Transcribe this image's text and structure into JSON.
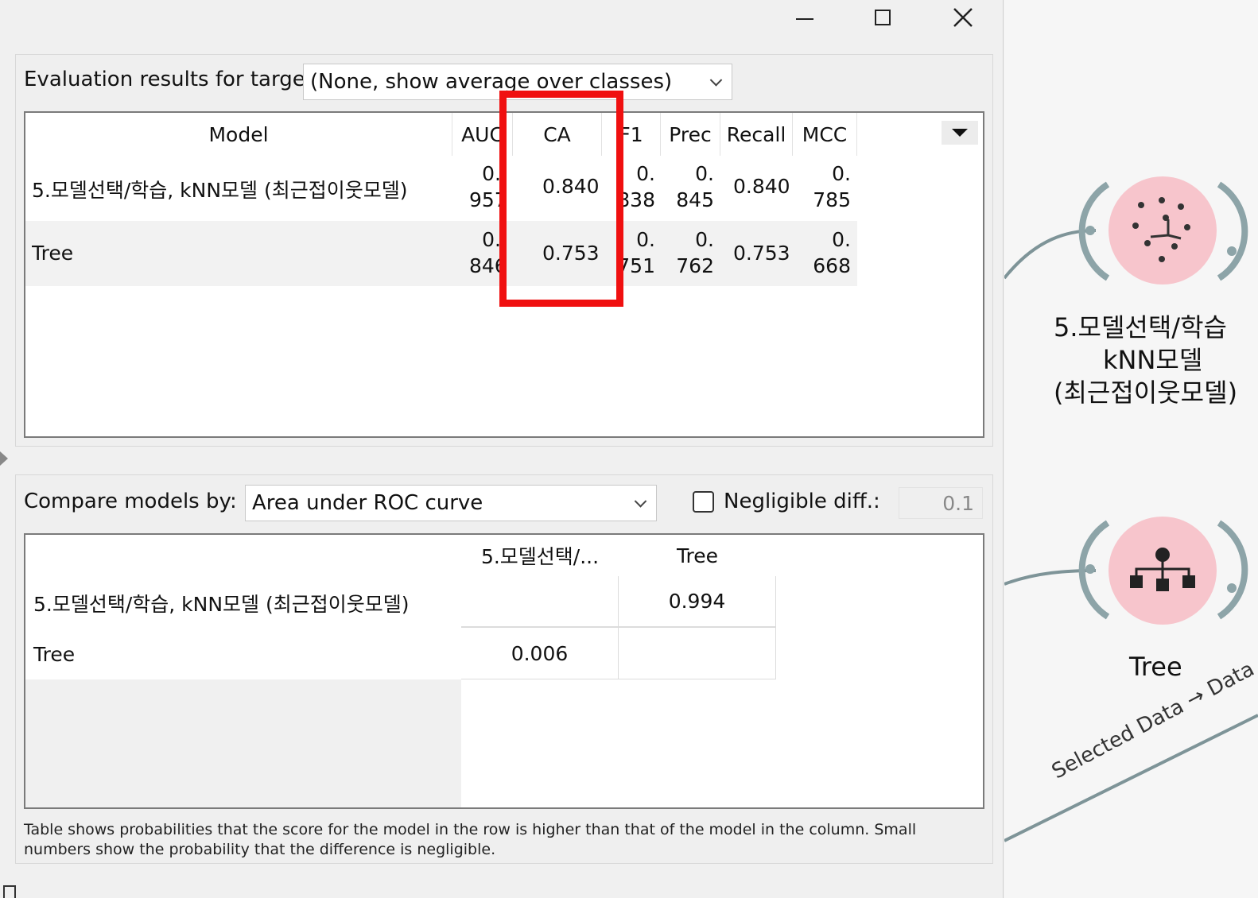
{
  "evaluation": {
    "target_label": "Evaluation results for target",
    "target_value": "(None, show average over classes)",
    "columns": [
      "Model",
      "AUC",
      "CA",
      "F1",
      "Prec",
      "Recall",
      "MCC"
    ],
    "rows": [
      {
        "model": "5.모델선택/학습, kNN모델 (최근접이웃모델)",
        "auc_top": "0.",
        "auc_bottom": "957",
        "ca": "0.840",
        "f1_top": "0.",
        "f1_bottom": "838",
        "prec_top": "0.",
        "prec_bottom": "845",
        "recall": "0.840",
        "mcc_top": "0.",
        "mcc_bottom": "785"
      },
      {
        "model": "Tree",
        "auc_top": "0.",
        "auc_bottom": "846",
        "ca": "0.753",
        "f1_top": "0.",
        "f1_bottom": "751",
        "prec_top": "0.",
        "prec_bottom": "762",
        "recall": "0.753",
        "mcc_top": "0.",
        "mcc_bottom": "668"
      }
    ]
  },
  "compare": {
    "label": "Compare models by:",
    "value": "Area under ROC curve",
    "negligible_label": "Negligible diff.:",
    "negligible_checked": false,
    "negligible_value": "0.1",
    "col_headers": [
      "5.모델선택/...",
      "Tree"
    ],
    "rows": [
      {
        "label": "5.모델선택/학습, kNN모델 (최근접이웃모델)",
        "values": [
          "",
          "0.994"
        ]
      },
      {
        "label": "Tree",
        "values": [
          "0.006",
          ""
        ]
      }
    ]
  },
  "footnote": "Table shows probabilities that the score for the model in the row is higher than that of the model in the column. Small numbers show the probability that the difference is negligible.",
  "canvas": {
    "knn_node_label_lines": [
      "5.모델선택/학습",
      "kNN모델",
      "(최근접이웃모델)"
    ],
    "tree_node_label": "Tree",
    "link_label": "Selected Data → Data"
  },
  "colors": {
    "highlight": "#f01010",
    "node_fill": "#f7c5cc"
  }
}
